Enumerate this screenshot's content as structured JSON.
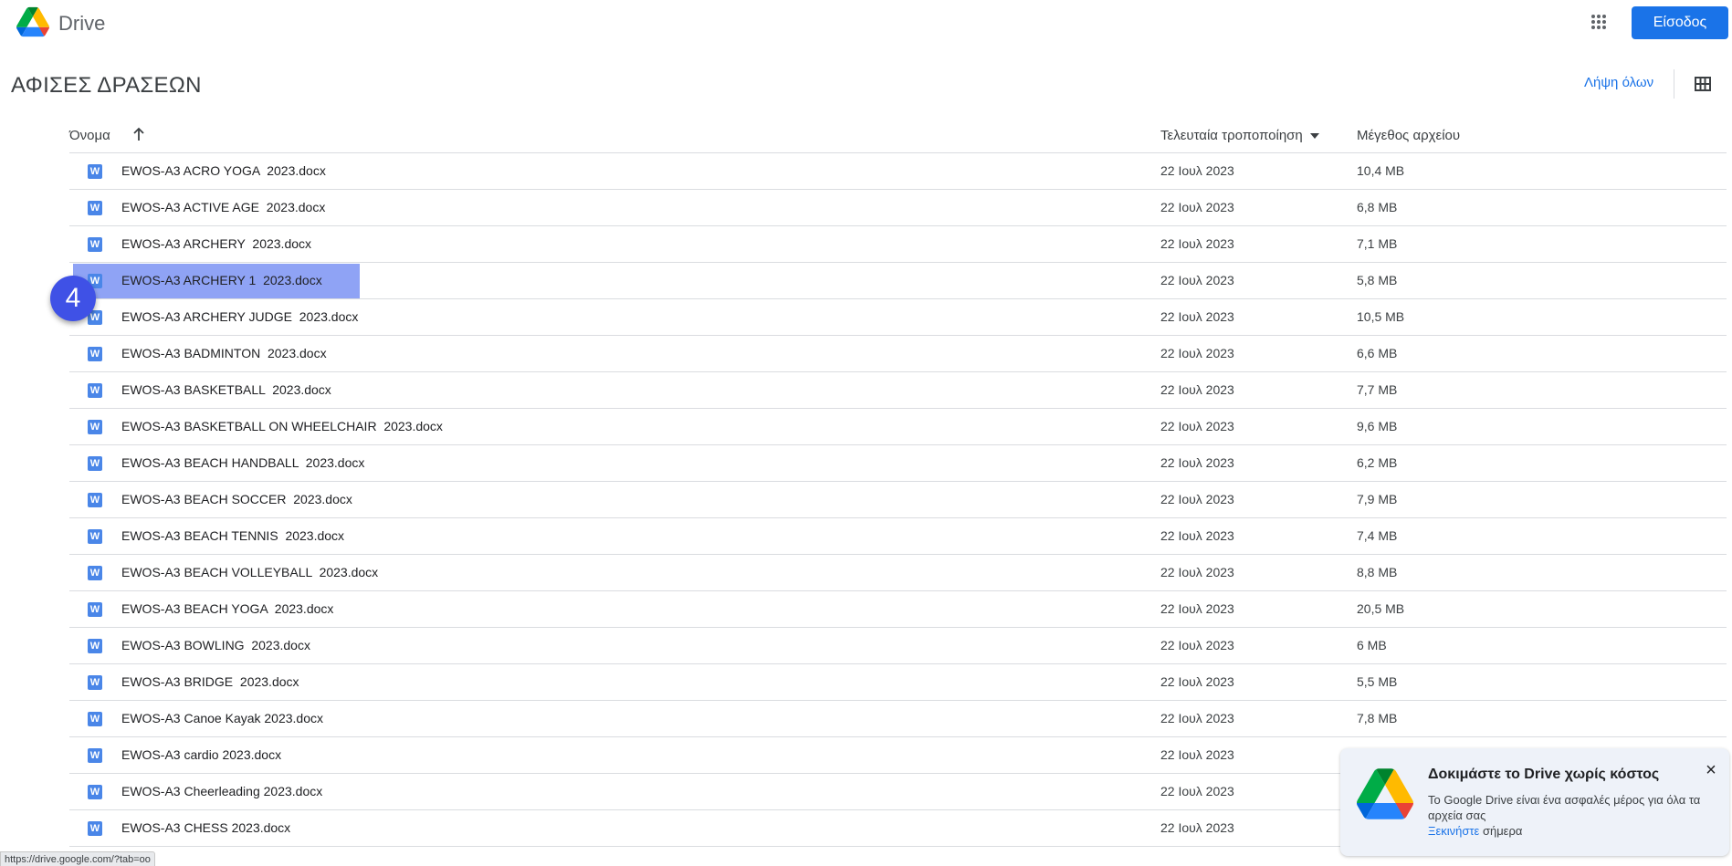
{
  "header": {
    "brand": "Drive",
    "apps_icon": "apps-grid-icon",
    "signin_label": "Είσοδος"
  },
  "folder": {
    "title": "ΑΦΙΣΕΣ ΔΡΑΣΕΩΝ",
    "download_all": "Λήψη όλων",
    "view_icon": "grid-view-icon"
  },
  "columns": {
    "name": "Όνομα",
    "modified": "Τελευταία τροποποίηση",
    "size": "Μέγεθος αρχείου"
  },
  "files": [
    {
      "name": "EWOS-A3 ACRO YOGA  2023.docx",
      "modified": "22 Ιουλ 2023",
      "size": "10,4 MB"
    },
    {
      "name": "EWOS-A3 ACTIVE AGE  2023.docx",
      "modified": "22 Ιουλ 2023",
      "size": "6,8 MB"
    },
    {
      "name": "EWOS-A3 ARCHERY  2023.docx",
      "modified": "22 Ιουλ 2023",
      "size": "7,1 MB"
    },
    {
      "name": "EWOS-A3 ARCHERY 1  2023.docx",
      "modified": "22 Ιουλ 2023",
      "size": "5,8 MB"
    },
    {
      "name": "EWOS-A3 ARCHERY JUDGE  2023.docx",
      "modified": "22 Ιουλ 2023",
      "size": "10,5 MB"
    },
    {
      "name": "EWOS-A3 BADMINTON  2023.docx",
      "modified": "22 Ιουλ 2023",
      "size": "6,6 MB"
    },
    {
      "name": "EWOS-A3 BASKETBALL  2023.docx",
      "modified": "22 Ιουλ 2023",
      "size": "7,7 MB"
    },
    {
      "name": "EWOS-A3 BASKETBALL ON WHEELCHAIR  2023.docx",
      "modified": "22 Ιουλ 2023",
      "size": "9,6 MB"
    },
    {
      "name": "EWOS-A3 BEACH HANDBALL  2023.docx",
      "modified": "22 Ιουλ 2023",
      "size": "6,2 MB"
    },
    {
      "name": "EWOS-A3 BEACH SOCCER  2023.docx",
      "modified": "22 Ιουλ 2023",
      "size": "7,9 MB"
    },
    {
      "name": "EWOS-A3 BEACH TENNIS  2023.docx",
      "modified": "22 Ιουλ 2023",
      "size": "7,4 MB"
    },
    {
      "name": "EWOS-A3 BEACH VOLLEYBALL  2023.docx",
      "modified": "22 Ιουλ 2023",
      "size": "8,8 MB"
    },
    {
      "name": "EWOS-A3 BEACH YOGA  2023.docx",
      "modified": "22 Ιουλ 2023",
      "size": "20,5 MB"
    },
    {
      "name": "EWOS-A3 BOWLING  2023.docx",
      "modified": "22 Ιουλ 2023",
      "size": "6 MB"
    },
    {
      "name": "EWOS-A3 BRIDGE  2023.docx",
      "modified": "22 Ιουλ 2023",
      "size": "5,5 MB"
    },
    {
      "name": "EWOS-A3 Canoe Kayak 2023.docx",
      "modified": "22 Ιουλ 2023",
      "size": "7,8 MB"
    },
    {
      "name": "EWOS-A3 cardio 2023.docx",
      "modified": "22 Ιουλ 2023",
      "size": ""
    },
    {
      "name": "EWOS-A3 Cheerleading 2023.docx",
      "modified": "22 Ιουλ 2023",
      "size": ""
    },
    {
      "name": "EWOS-A3 CHESS 2023.docx",
      "modified": "22 Ιουλ 2023",
      "size": ""
    }
  ],
  "file_icon_letter": "W",
  "highlighted_row_index": 3,
  "step_badge": "4",
  "status_url": "https://drive.google.com/?tab=oo",
  "promo": {
    "title": "Δοκιμάστε το Drive χωρίς κόστος",
    "body": "Το Google Drive είναι ένα ασφαλές μέρος για όλα τα αρχεία σας",
    "link": "Ξεκινήστε",
    "link_suffix": " σήμερα",
    "close_icon": "close-icon"
  },
  "colors": {
    "accent": "#1a73e8",
    "highlight": "#8fa3f5",
    "badge": "#3f51e6",
    "word_icon": "#4a86e8"
  }
}
